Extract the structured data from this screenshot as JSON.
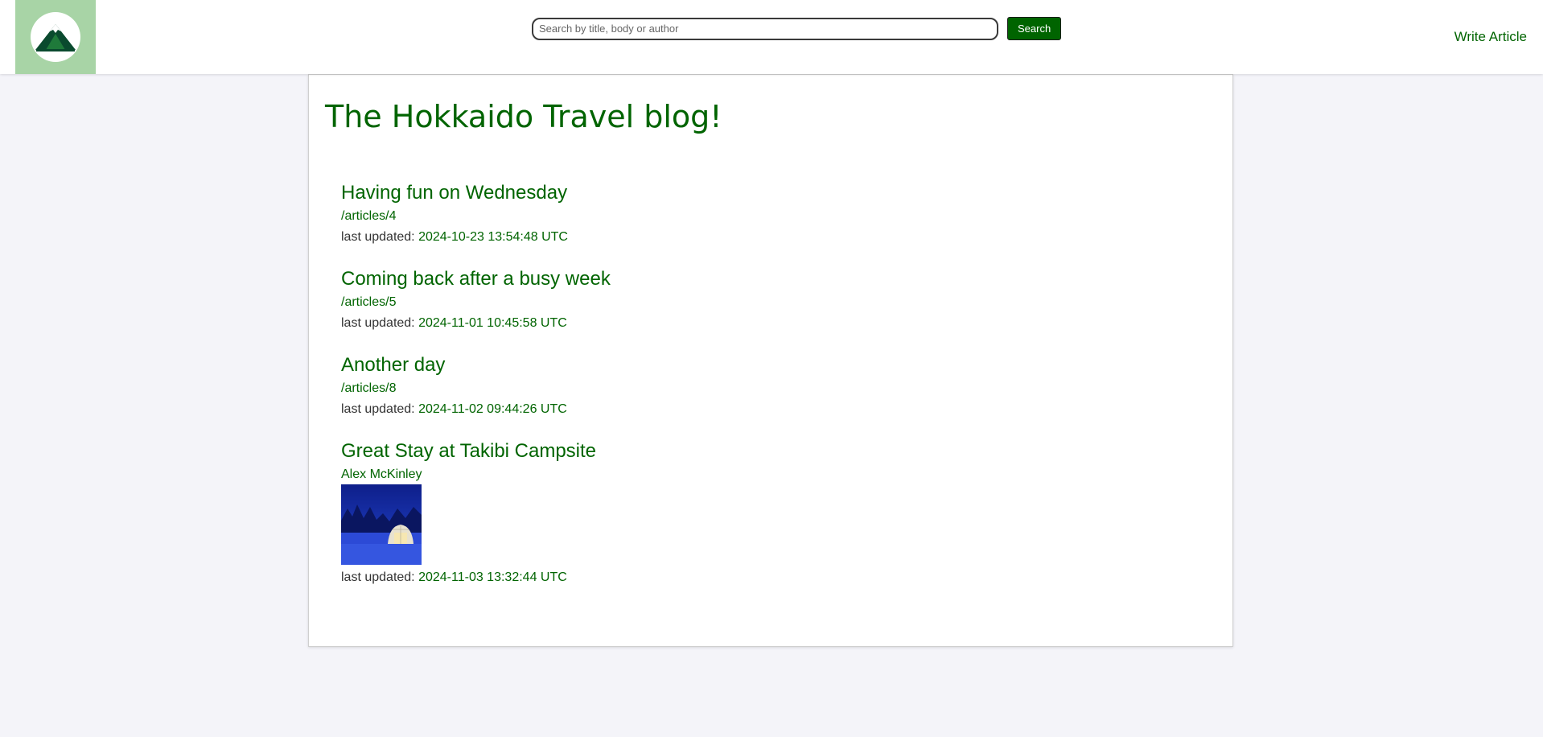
{
  "header": {
    "search": {
      "placeholder": "Search by title, body or author",
      "button_label": "Search"
    },
    "write_article_label": "Write Article"
  },
  "blog_title": "The Hokkaido Travel blog!",
  "meta_label": "last updated:",
  "articles": [
    {
      "title": "Having fun on Wednesday",
      "link_text": "/articles/4",
      "last_updated": "2024-10-23 13:54:48 UTC"
    },
    {
      "title": "Coming back after a busy week",
      "link_text": "/articles/5",
      "last_updated": "2024-11-01 10:45:58 UTC"
    },
    {
      "title": "Another day",
      "link_text": "/articles/8",
      "last_updated": "2024-11-02 09:44:26 UTC"
    },
    {
      "title": "Great Stay at Takibi Campsite",
      "link_text": "Alex McKinley",
      "has_image": true,
      "last_updated": "2024-11-03 13:32:44 UTC"
    }
  ],
  "colors": {
    "accent": "#006400",
    "logo_bg": "#a8d4a6",
    "page_bg": "#f4f4f9"
  }
}
